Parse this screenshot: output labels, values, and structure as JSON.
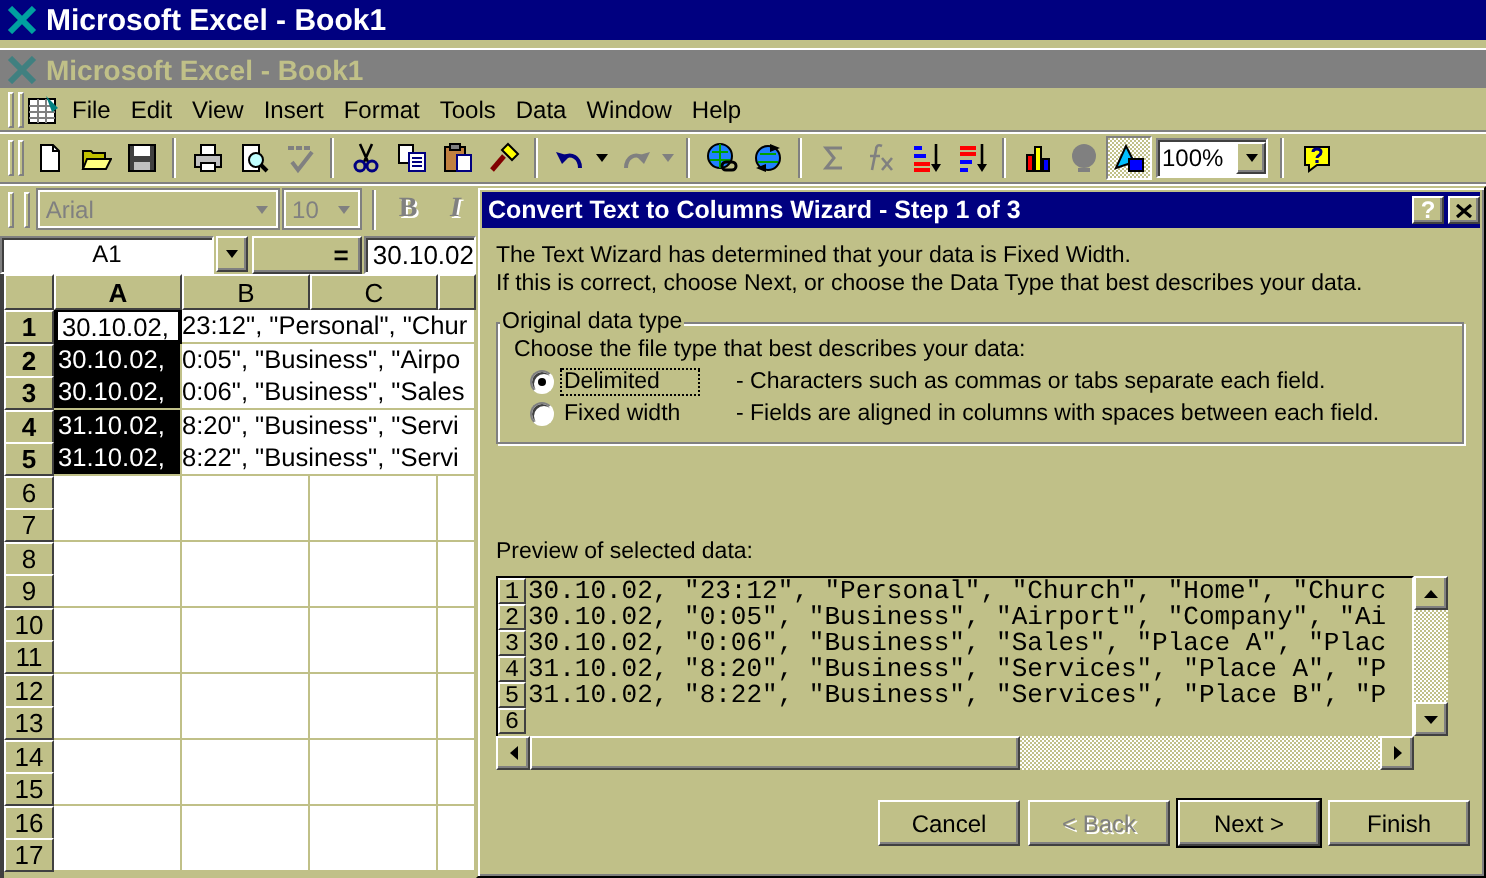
{
  "app_title": "Microsoft Excel - Book1",
  "workbook_title": "Microsoft Excel - Book1",
  "menu": [
    "File",
    "Edit",
    "View",
    "Insert",
    "Format",
    "Tools",
    "Data",
    "Window",
    "Help"
  ],
  "toolbar_groups": [
    {
      "items": [
        {
          "kind": "new",
          "disabled": false,
          "pressed": false
        },
        {
          "kind": "open",
          "disabled": false,
          "pressed": false
        },
        {
          "kind": "save",
          "disabled": false,
          "pressed": false
        }
      ]
    },
    {
      "items": [
        {
          "kind": "print",
          "disabled": false,
          "pressed": false
        },
        {
          "kind": "preview",
          "disabled": false,
          "pressed": false
        },
        {
          "kind": "spelling",
          "disabled": true,
          "pressed": false
        }
      ]
    },
    {
      "items": [
        {
          "kind": "cut",
          "disabled": false,
          "pressed": false
        },
        {
          "kind": "copy",
          "disabled": false,
          "pressed": false
        },
        {
          "kind": "paste",
          "disabled": false,
          "pressed": false
        },
        {
          "kind": "painter",
          "disabled": false,
          "pressed": false
        }
      ]
    },
    {
      "items": [
        {
          "kind": "undo",
          "disabled": false,
          "pressed": false
        },
        {
          "kind": "caret",
          "disabled": false,
          "pressed": false
        },
        {
          "kind": "redo",
          "disabled": true,
          "pressed": false
        },
        {
          "kind": "caret",
          "disabled": true,
          "pressed": false
        }
      ]
    },
    {
      "items": [
        {
          "kind": "hyperlink",
          "disabled": false,
          "pressed": false
        },
        {
          "kind": "webbar",
          "disabled": false,
          "pressed": false
        }
      ]
    },
    {
      "items": [
        {
          "kind": "autosum",
          "disabled": true,
          "pressed": false
        },
        {
          "kind": "function",
          "disabled": true,
          "pressed": false
        },
        {
          "kind": "sort_asc",
          "disabled": false,
          "pressed": false
        },
        {
          "kind": "sort_desc",
          "disabled": false,
          "pressed": false
        }
      ]
    },
    {
      "items": [
        {
          "kind": "chart",
          "disabled": false,
          "pressed": false
        },
        {
          "kind": "map",
          "disabled": true,
          "pressed": false
        },
        {
          "kind": "drawing",
          "disabled": false,
          "pressed": true
        },
        {
          "kind": "combo",
          "value": "100%",
          "disabled": false
        }
      ]
    },
    {
      "items": [
        {
          "kind": "assistant",
          "disabled": false,
          "pressed": false
        }
      ]
    }
  ],
  "format_toolbar": {
    "font": "Arial",
    "size": "10",
    "bold": "B",
    "italic": "I"
  },
  "formula_bar": {
    "name_box": "A1",
    "equals": "=",
    "formula": "30.10.02"
  },
  "sheet": {
    "columns": [
      {
        "label": "A",
        "selected": true
      },
      {
        "label": "B",
        "selected": false
      },
      {
        "label": "C",
        "selected": false
      }
    ],
    "rows": [
      {
        "number": "1",
        "selected": true,
        "active": true,
        "cell_a": "30.10.02,",
        "overflow": "23:12\", \"Personal\", \"Chur"
      },
      {
        "number": "2",
        "selected": true,
        "active": false,
        "cell_a": "30.10.02,",
        "overflow": "0:05\", \"Business\", \"Airpo"
      },
      {
        "number": "3",
        "selected": true,
        "active": false,
        "cell_a": "30.10.02,",
        "overflow": "0:06\", \"Business\", \"Sales"
      },
      {
        "number": "4",
        "selected": true,
        "active": false,
        "cell_a": "31.10.02,",
        "overflow": "8:20\", \"Business\", \"Servi"
      },
      {
        "number": "5",
        "selected": true,
        "active": false,
        "cell_a": "31.10.02,",
        "overflow": "8:22\", \"Business\", \"Servi"
      },
      {
        "number": "6",
        "selected": false,
        "active": false
      },
      {
        "number": "7",
        "selected": false,
        "active": false
      },
      {
        "number": "8",
        "selected": false,
        "active": false
      },
      {
        "number": "9",
        "selected": false,
        "active": false
      },
      {
        "number": "10",
        "selected": false,
        "active": false
      },
      {
        "number": "11",
        "selected": false,
        "active": false
      },
      {
        "number": "12",
        "selected": false,
        "active": false
      },
      {
        "number": "13",
        "selected": false,
        "active": false
      },
      {
        "number": "14",
        "selected": false,
        "active": false
      },
      {
        "number": "15",
        "selected": false,
        "active": false
      },
      {
        "number": "16",
        "selected": false,
        "active": false
      },
      {
        "number": "17",
        "selected": false,
        "active": false
      }
    ]
  },
  "dialog": {
    "title": "Convert Text to Columns Wizard - Step 1 of 3",
    "help": "?",
    "intro": [
      "The Text Wizard has determined that your data is Fixed Width.",
      "If this is correct, choose Next, or choose the Data Type that best describes your data."
    ],
    "group_label": "Original data type",
    "prompt": "Choose the file type that best describes your data:",
    "options": [
      {
        "label": "Delimited",
        "description": "- Characters such as commas or tabs separate each field.",
        "selected": true,
        "focused": true
      },
      {
        "label": "Fixed width",
        "description": "- Fields are aligned in columns with spaces between each field.",
        "selected": false,
        "focused": false
      }
    ],
    "preview_label": "Preview of selected data:",
    "preview_rows": [
      {
        "number": "1",
        "text": "30.10.02, \"23:12\", \"Personal\", \"Church\", \"Home\", \"Churc"
      },
      {
        "number": "2",
        "text": "30.10.02, \"0:05\", \"Business\", \"Airport\", \"Company\", \"Ai"
      },
      {
        "number": "3",
        "text": "30.10.02, \"0:06\", \"Business\", \"Sales\", \"Place A\", \"Plac"
      },
      {
        "number": "4",
        "text": "31.10.02, \"8:20\", \"Business\", \"Services\", \"Place A\", \"P"
      },
      {
        "number": "5",
        "text": "31.10.02, \"8:22\", \"Business\", \"Services\", \"Place B\", \"P"
      },
      {
        "number": "6",
        "text": ""
      }
    ],
    "buttons": [
      {
        "label": "Cancel",
        "disabled": false,
        "default": false
      },
      {
        "label": "< Back",
        "disabled": true,
        "default": false
      },
      {
        "label": "Next >",
        "disabled": false,
        "default": true
      },
      {
        "label": "Finish",
        "disabled": false,
        "default": false
      }
    ]
  }
}
